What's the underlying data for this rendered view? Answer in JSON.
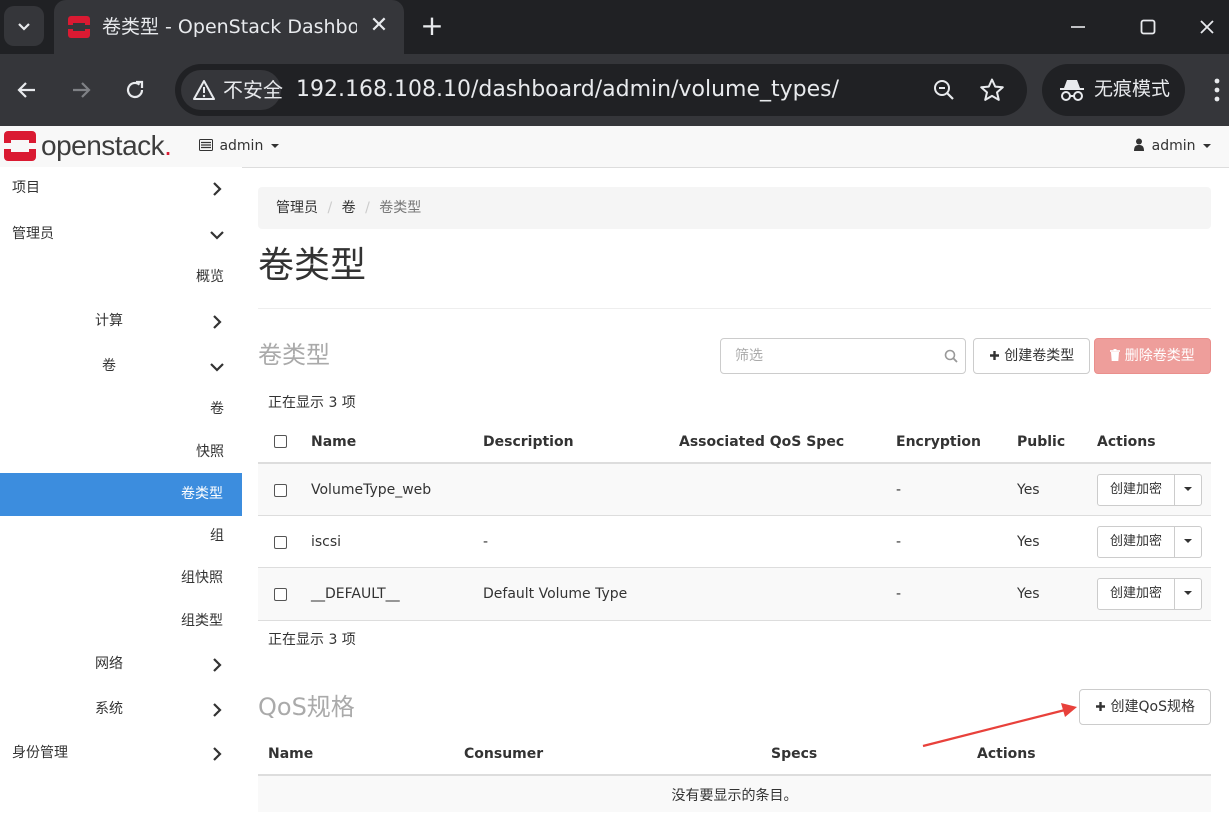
{
  "browser": {
    "tab_title": "卷类型 - OpenStack Dashboard",
    "new_tab": "+",
    "close": "✕",
    "security_label": "不安全",
    "url": "192.168.108.10/dashboard/admin/volume_types/",
    "incognito_label": "无痕模式"
  },
  "topnav": {
    "brand": "openstack",
    "brand_dot": ".",
    "project_label": "admin",
    "user_label": "admin"
  },
  "sidebar": {
    "project": "项目",
    "admin": "管理员",
    "overview": "概览",
    "compute": "计算",
    "volume_group": "卷",
    "volumes": "卷",
    "snapshots": "快照",
    "volume_types": "卷类型",
    "groups": "组",
    "group_snapshots": "组快照",
    "group_types": "组类型",
    "network": "网络",
    "system": "系统",
    "identity": "身份管理"
  },
  "breadcrumb": [
    "管理员",
    "卷",
    "卷类型"
  ],
  "page_title": "卷类型",
  "volume_types": {
    "section_title": "卷类型",
    "filter_placeholder": "筛选",
    "create_label": "创建卷类型",
    "delete_label": "删除卷类型",
    "count_text": "正在显示 3 项",
    "columns": {
      "name": "Name",
      "description": "Description",
      "qos": "Associated QoS Spec",
      "encryption": "Encryption",
      "public": "Public",
      "actions": "Actions"
    },
    "rows": [
      {
        "name": "VolumeType_web",
        "description": "",
        "qos": "",
        "encryption": "-",
        "public": "Yes",
        "action": "创建加密"
      },
      {
        "name": "iscsi",
        "description": "-",
        "qos": "",
        "encryption": "-",
        "public": "Yes",
        "action": "创建加密"
      },
      {
        "name": "__DEFAULT__",
        "description": "Default Volume Type",
        "qos": "",
        "encryption": "-",
        "public": "Yes",
        "action": "创建加密"
      }
    ]
  },
  "qos": {
    "section_title": "QoS规格",
    "create_label": "创建QoS规格",
    "columns": {
      "name": "Name",
      "consumer": "Consumer",
      "specs": "Specs",
      "actions": "Actions"
    },
    "empty_text": "没有要显示的条目。"
  },
  "colors": {
    "active": "#3c8dde",
    "danger": "#ee9e9b",
    "brand_red": "#da1a32",
    "annotation_arrow": "#e8413b"
  }
}
